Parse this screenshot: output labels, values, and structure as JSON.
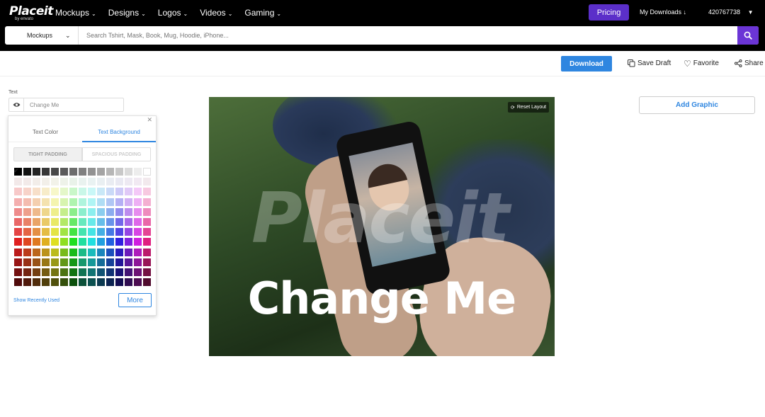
{
  "logo": {
    "main": "Placeit",
    "sub": "by envato"
  },
  "nav": {
    "items": [
      {
        "label": "Mockups"
      },
      {
        "label": "Designs"
      },
      {
        "label": "Logos"
      },
      {
        "label": "Videos"
      },
      {
        "label": "Gaming"
      }
    ],
    "pricing": "Pricing",
    "my_downloads": "My Downloads ↓",
    "account": "420767738"
  },
  "search": {
    "category": "Mockups",
    "placeholder": "Search Tshirt, Mask, Book, Mug, Hoodie, iPhone..."
  },
  "toolbar": {
    "download": "Download",
    "save_draft": "Save Draft",
    "favorite": "Favorite",
    "share": "Share"
  },
  "editor": {
    "text_label": "Text",
    "text_value": "Change Me",
    "tabs": {
      "text_color": "Text Color",
      "text_background": "Text Background"
    },
    "padding": {
      "tight": "TIGHT PADDING",
      "spacious": "SPACIOUS PADDING"
    },
    "show_recent": "Show Recently Used",
    "more": "More"
  },
  "canvas": {
    "overlay_text": "Change Me",
    "watermark": "Placeit",
    "reset_layout": "Reset Layout"
  },
  "sidebar": {
    "add_graphic": "Add Graphic"
  },
  "colors": {
    "accent": "#2f86e0",
    "pricing_purple": "#5b2fc9",
    "search_purple": "#6b35d6",
    "nav_bg": "#000000"
  }
}
